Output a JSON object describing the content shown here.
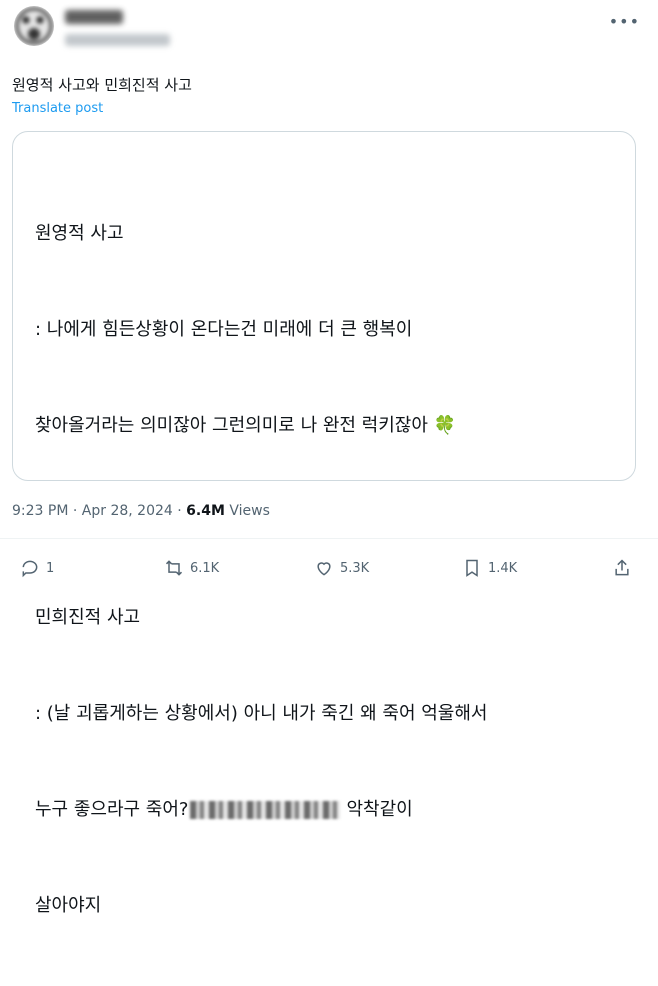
{
  "post": {
    "text": "원영적 사고와 민희진적 사고",
    "translate_label": "Translate post",
    "time": "9:23 PM",
    "sep": "·",
    "date": "Apr 28, 2024",
    "views_count": "6.4M",
    "views_label": "Views"
  },
  "card": {
    "heading1": "원영적 사고",
    "line1": ": 나에게 힘든상황이 온다는건 미래에 더 큰 행복이",
    "line2": "찾아올거라는 의미잖아 그런의미로 나 완전 럭키잖아 ",
    "clover": "🍀",
    "heading2": "민희진적 사고",
    "line3": ": (날 괴롭게하는 상황에서) 아니 내가 죽긴 왜 죽어 억울해서",
    "line4_a": "누구 좋으라구 죽어?",
    "line4_b": "악착같이",
    "line5": "살아야지"
  },
  "actions": {
    "replies": "1",
    "reposts": "6.1K",
    "likes": "5.3K",
    "bookmarks": "1.4K"
  },
  "icons": [
    "more-icon",
    "reply-icon",
    "repost-icon",
    "like-icon",
    "bookmark-icon",
    "share-icon"
  ]
}
